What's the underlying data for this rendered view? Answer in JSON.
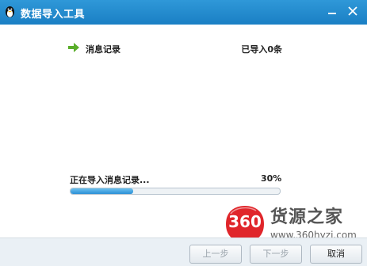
{
  "window": {
    "title": "数据导入工具",
    "minimize_icon": "minimize-icon",
    "close_icon": "close-icon"
  },
  "item": {
    "icon": "arrow-right-icon",
    "label": "消息记录",
    "status": "已导入0条"
  },
  "progress": {
    "text": "正在导入消息记录...",
    "percent_label": "30%",
    "value": 0.3
  },
  "footer": {
    "prev_label": "上一步",
    "next_label": "下一步",
    "cancel_label": "取消"
  },
  "watermark": {
    "badge": "360",
    "name": "货源之家",
    "url": "www.360hyzj.com"
  },
  "colors": {
    "titlebar": "#1a7fc4",
    "progress_fill": "#2b8fd6",
    "arrow": "#5aae2b",
    "badge": "#e0262b"
  }
}
